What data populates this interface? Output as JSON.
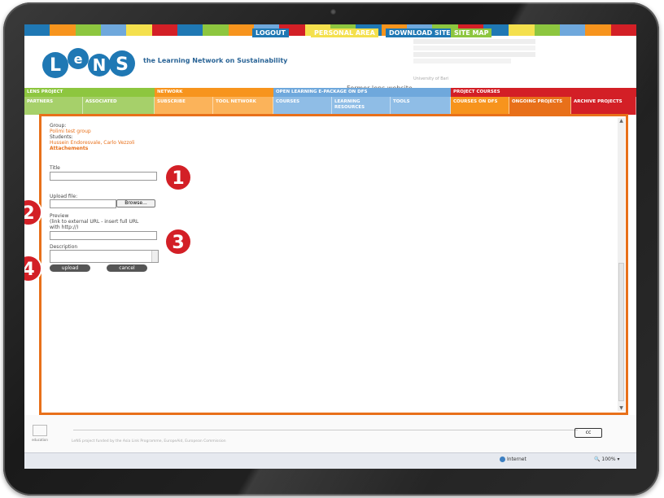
{
  "topnav": {
    "logout": "LOGOUT",
    "personal_area": "PERSONAL AREA",
    "download_site": "DOWNLOAD SITE",
    "site_map": "SITE MAP"
  },
  "header": {
    "logo_text": "LeNS",
    "tagline": "the Learning Network on Sustainability",
    "former_site": "Former lens website",
    "university": "University of Bari"
  },
  "sections": [
    "LENS PROJECT",
    "NETWORK",
    "OPEN LEARNING E-PACKAGE ON DFS",
    "PROJECT COURSES"
  ],
  "subsections": [
    [
      "PARTNERS",
      "ASSOCIATED"
    ],
    [
      "SUBSCRIBE",
      "TOOL NETWORK"
    ],
    [
      "COURSES",
      "LEARNING RESOURCES",
      "TOOLS"
    ],
    [
      "COURSES ON DFS",
      "ONGOING PROJECTS",
      "ARCHIVE PROJECTS"
    ]
  ],
  "form": {
    "group_label": "Group:",
    "group_value": "Polimi test group",
    "students_label": "Students:",
    "students_value": "Hussein Endoresvale, Carlo Vezzoli",
    "attachments": "Attachements",
    "title_label": "Title",
    "title_value": "",
    "upload_label": "Upload file:",
    "upload_value": "",
    "browse": "Browse...",
    "preview_label_1": "Preview",
    "preview_label_2": "(link to external URL - insert full URL",
    "preview_label_3": "with http://)",
    "preview_value": "",
    "description_label": "Description",
    "upload_button": "upload",
    "cancel_button": "cancel"
  },
  "badges": [
    "1",
    "2",
    "3",
    "4"
  ],
  "footer": {
    "cc": "cc",
    "eu": "education",
    "note": "LeNS project funded by the Asia Link Programme, EuropeAid, European Commission"
  },
  "statusbar": {
    "zone": "Internet",
    "zoom": "100%"
  },
  "colors": {
    "green": "#8dc63f",
    "orange": "#f7941d",
    "blue": "#6fa8dc",
    "red": "#d31f26",
    "accent_orange": "#e8701a"
  }
}
